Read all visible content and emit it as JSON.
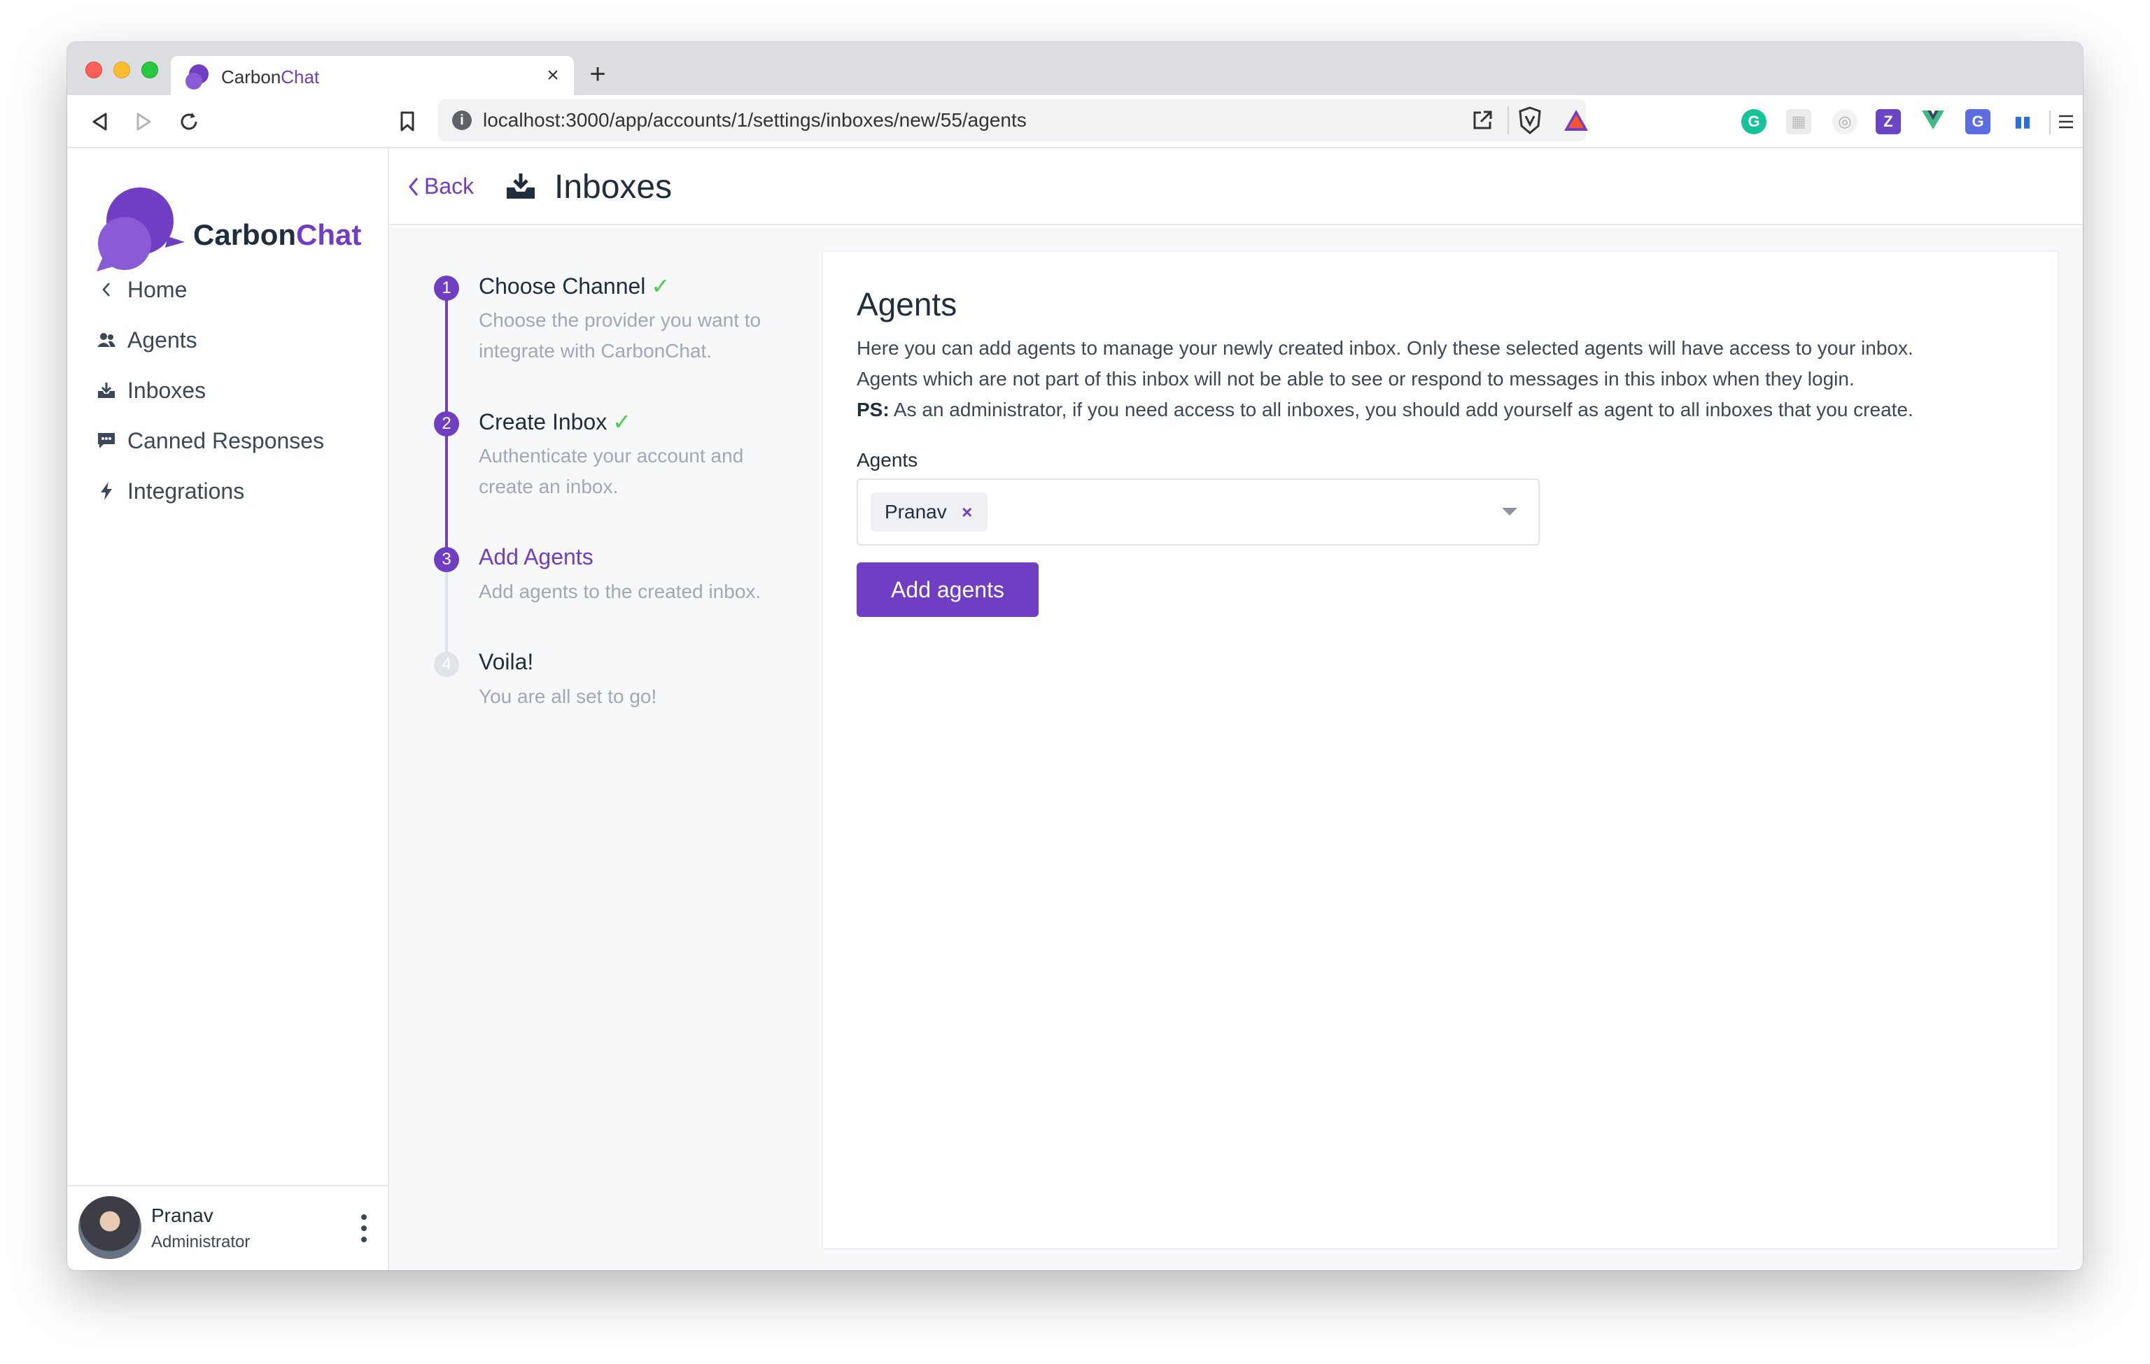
{
  "browser": {
    "tab": {
      "title_part1": "Carbon",
      "title_part2": "Chat",
      "close_label": "×"
    },
    "new_tab_label": "+",
    "url": "localhost:3000/app/accounts/1/settings/inboxes/new/55/agents"
  },
  "sidebar": {
    "logo": {
      "part1": "Carbon",
      "part2": "Chat"
    },
    "items": [
      {
        "label": "Home",
        "icon": "chevron-left-icon"
      },
      {
        "label": "Agents",
        "icon": "people-icon"
      },
      {
        "label": "Inboxes",
        "icon": "inbox-icon"
      },
      {
        "label": "Canned Responses",
        "icon": "chat-bubble-icon"
      },
      {
        "label": "Integrations",
        "icon": "lightning-icon"
      }
    ],
    "user": {
      "name": "Pranav",
      "role": "Administrator"
    }
  },
  "header": {
    "back_label": "Back",
    "title": "Inboxes"
  },
  "wizard": {
    "steps": [
      {
        "number": "1",
        "title": "Choose Channel",
        "done": true,
        "desc": "Choose the provider you want to integrate with CarbonChat."
      },
      {
        "number": "2",
        "title": "Create Inbox",
        "done": true,
        "desc": "Authenticate your account and create an inbox."
      },
      {
        "number": "3",
        "title": "Add Agents",
        "active": true,
        "desc": "Add agents to the created inbox."
      },
      {
        "number": "4",
        "title": "Voila!",
        "desc": "You are all set to go!"
      }
    ],
    "check_mark": "✓"
  },
  "card": {
    "title": "Agents",
    "desc_line1": "Here you can add agents to manage your newly created inbox. Only these selected agents will have access to your inbox.",
    "desc_line2": "Agents which are not part of this inbox will not be able to see or respond to messages in this inbox when they login.",
    "desc_ps_label": "PS:",
    "desc_ps_text": " As an administrator, if you need access to all inboxes, you should add yourself as agent to all inboxes that you create.",
    "field_label": "Agents",
    "selected_agents": [
      "Pranav"
    ],
    "tag_remove": "×",
    "submit_label": "Add agents"
  },
  "colors": {
    "accent": "#703ec2",
    "success": "#44ce4b",
    "text": "#1f2d3d",
    "muted": "#a0a8b5"
  }
}
